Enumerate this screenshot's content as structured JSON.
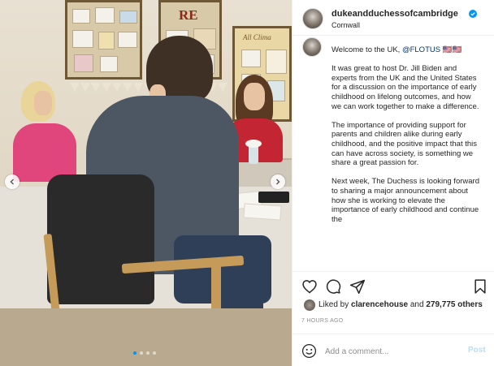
{
  "post": {
    "username": "dukeandduchessofcambridge",
    "location": "Cornwall",
    "verified": true,
    "carousel": {
      "slide_count": 4,
      "active_index": 0
    },
    "board_letters": "RE",
    "board_small_text": "All Clima"
  },
  "caption": {
    "greeting": "Welcome to the UK, ",
    "mention": "@FLOTUS",
    "greeting_suffix": " 🇺🇸🇺🇸",
    "paragraphs": [
      "It was great to host Dr. Jill Biden and experts from the UK and the United States for a discussion on the importance of early childhood on lifelong outcomes, and how we can work together to make a difference.",
      "The importance of providing support for parents and children alike during early childhood, and the positive impact that this can have across society, is something we share a great passion for.",
      "Next week, The Duchess is looking forward to sharing a major announcement about how she is working to elevate the importance of early childhood and continue the"
    ]
  },
  "engagement": {
    "liked_by_prefix": "Liked by ",
    "liked_by_user": "clarencehouse",
    "and_text": " and ",
    "others_count": "279,775 others",
    "timestamp": "7 HOURS AGO"
  },
  "comment": {
    "placeholder": "Add a comment...",
    "post_label": "Post"
  },
  "icons": {
    "like": "heart-icon",
    "comment": "comment-icon",
    "share": "share-icon",
    "save": "bookmark-icon",
    "emoji": "emoji-icon",
    "verified": "verified-badge-icon",
    "prev": "chevron-left-icon",
    "next": "chevron-right-icon"
  },
  "colors": {
    "verified_blue": "#0095f6",
    "mention_blue": "#00376b",
    "post_button_disabled": "#b2dffc",
    "muted_text": "#8e8e8e"
  }
}
